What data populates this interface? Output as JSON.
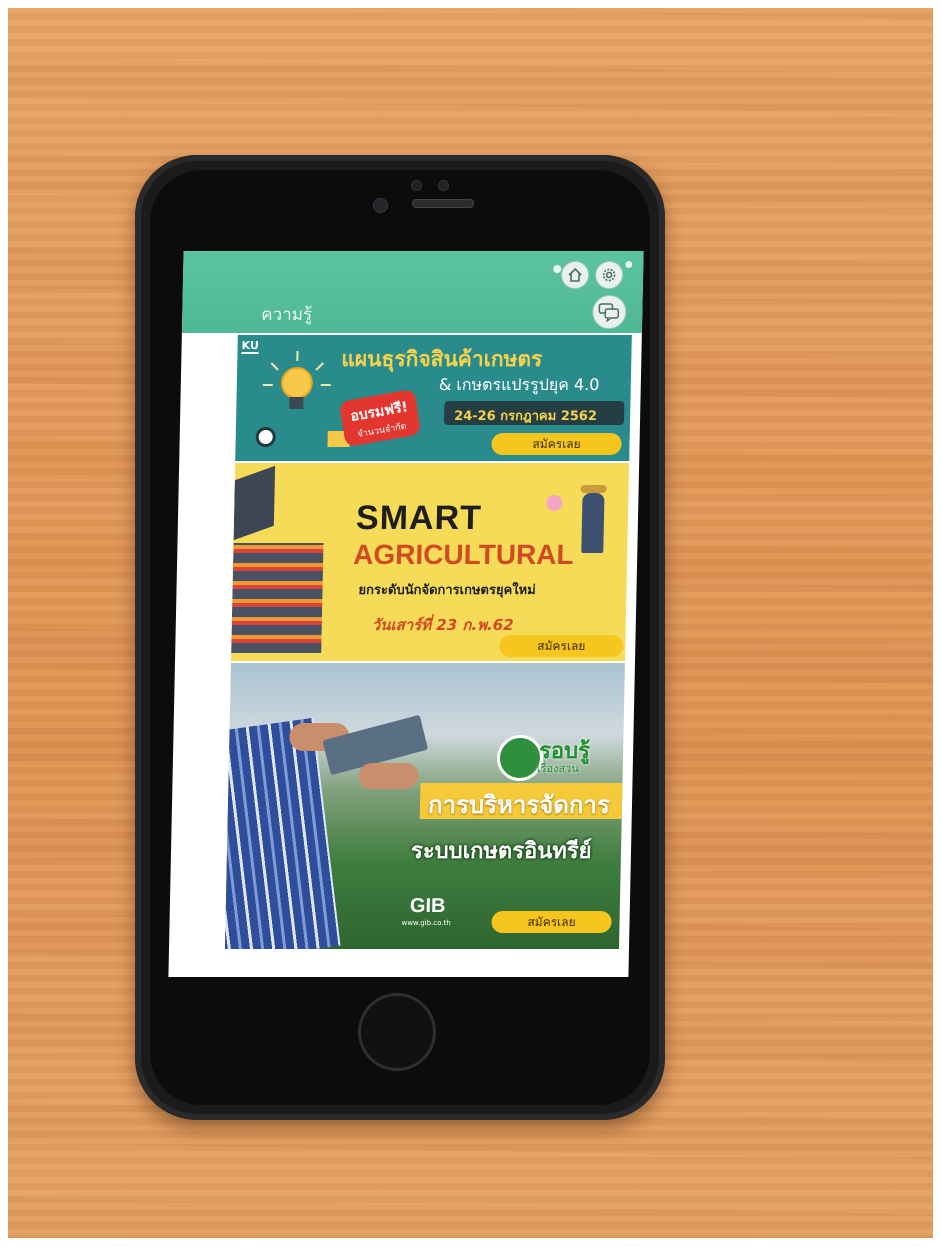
{
  "header": {
    "title": "ความรู้",
    "icons": [
      "home-icon",
      "gear-icon",
      "chat-icon"
    ]
  },
  "banners": [
    {
      "logo": "KU",
      "title": "แผนธุรกิจสินค้าเกษตร",
      "subtitle": "& เกษตรแปรรูปยุค 4.0",
      "date": "24-26 กรกฎาคม  2562",
      "badge_line1": "อบรมฟรี!",
      "badge_line2": "จำนวนจำกัด",
      "cta": "สมัครเลย"
    },
    {
      "title_line1": "SMART",
      "title_line2": "AGRICULTURAL",
      "subtitle": "ยกระดับนักจัดการเกษตรยุคใหม่",
      "date": "วันเสาร์ที่ 23 ก.พ.62",
      "cta": "สมัครเลย"
    },
    {
      "tag_line1": "รอบรู้",
      "tag_line2": "เรื่องสวน",
      "title_line1": "การบริหารจัดการ",
      "title_line2": "ระบบเกษตรอินทรีย์",
      "logo": "GIB",
      "logo_url": "www.gib.co.th",
      "cta": "สมัครเลย"
    }
  ]
}
